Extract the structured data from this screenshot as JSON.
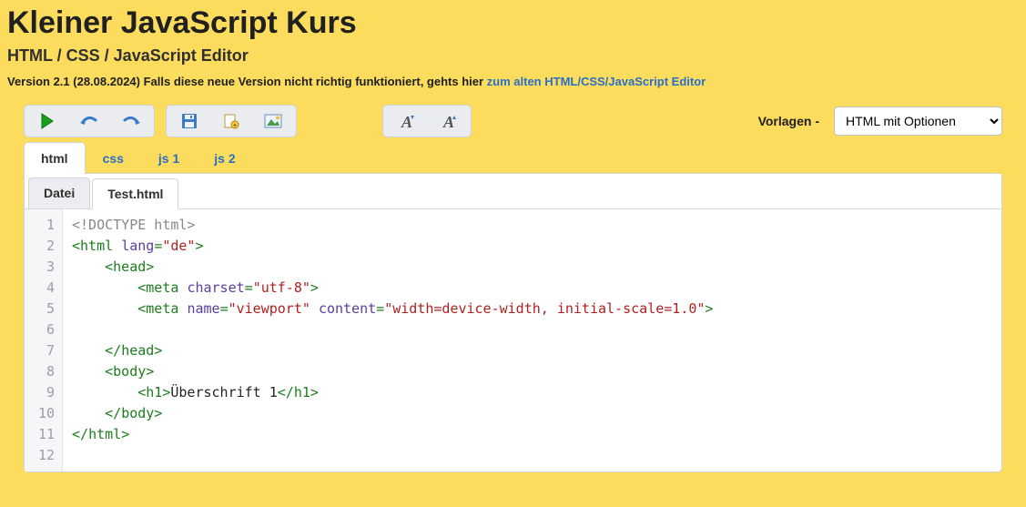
{
  "page_title": "Kleiner JavaScript Kurs",
  "subtitle": "HTML / CSS / JavaScript Editor",
  "version_prefix": "Version 2.1 (28.08.2024) Falls diese neue Version nicht richtig funktioniert, gehts hier ",
  "version_link_text": "zum alten HTML/CSS/JavaScript Editor",
  "templates_label": "Vorlagen -",
  "templates_selected": "HTML mit Optionen",
  "filetype_tabs": {
    "0": {
      "label": "html",
      "active": true
    },
    "1": {
      "label": "css"
    },
    "2": {
      "label": "js 1"
    },
    "3": {
      "label": "js 2"
    }
  },
  "file_tabs": {
    "0": {
      "label": "Datei"
    },
    "1": {
      "label": "Test.html",
      "active": true
    }
  },
  "toolbar": {
    "run": "Run",
    "undo": "Undo",
    "redo": "Redo",
    "save": "Save",
    "new": "New file",
    "image": "Insert image",
    "font_dec": "Decrease font",
    "font_inc": "Increase font"
  },
  "gutter_lines": [
    "1",
    "2",
    "3",
    "4",
    "5",
    "6",
    "7",
    "8",
    "9",
    "10",
    "11",
    "12"
  ],
  "code_text": {
    "l1_doctype": "<!DOCTYPE html>",
    "l9_text": "Überschrift 1"
  }
}
